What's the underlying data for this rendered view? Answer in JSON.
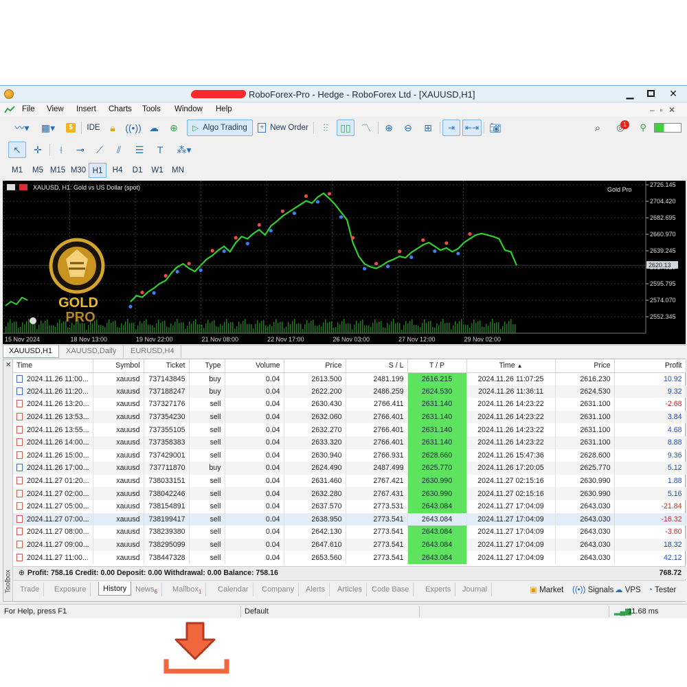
{
  "window": {
    "title": "RoboForex-Pro - Hedge - RoboForex Ltd - [XAUUSD,H1]"
  },
  "menu": [
    "File",
    "View",
    "Insert",
    "Charts",
    "Tools",
    "Window",
    "Help"
  ],
  "toolbar": {
    "ide": "IDE",
    "algo_trading": "Algo Trading",
    "new_order": "New Order",
    "notification_count": "1"
  },
  "timeframes": [
    "M1",
    "M5",
    "M15",
    "M30",
    "H1",
    "H4",
    "D1",
    "W1",
    "MN"
  ],
  "active_timeframe": "H1",
  "chart": {
    "symbol_label": "XAUUSD, H1:  Gold vs US Dollar (spot)",
    "indicator_label": "Gold Pro",
    "logo_text_1": "GOLD",
    "logo_text_2": "PRO",
    "current_price": "2620.13",
    "price_ticks": [
      "2726.145",
      "2704.420",
      "2682.695",
      "2660.970",
      "2639.245",
      "2617.520",
      "2595.795",
      "2574.070",
      "2552.345"
    ],
    "time_ticks": [
      "15 Nov 2024",
      "18 Nov 13:00",
      "19 Nov 22:00",
      "21 Nov 08:00",
      "22 Nov 17:00",
      "26 Nov 03:00",
      "27 Nov 12:00",
      "29 Nov 02:00"
    ],
    "price_min": 2530.62,
    "price_max": 2726.145,
    "series": [
      2572,
      2580,
      2578,
      2585,
      2590,
      2596,
      2600,
      2610,
      2618,
      2622,
      2616,
      2612,
      2620,
      2628,
      2633,
      2640,
      2645,
      2638,
      2650,
      2658,
      2655,
      2662,
      2667,
      2660,
      2672,
      2678,
      2685,
      2690,
      2695,
      2700,
      2705,
      2702,
      2710,
      2715,
      2708,
      2700,
      2690,
      2680,
      2650,
      2632,
      2622,
      2618,
      2616,
      2620,
      2625,
      2628,
      2632,
      2630,
      2637,
      2642,
      2647,
      2650,
      2645,
      2640,
      2643,
      2638,
      2642,
      2650,
      2655,
      2660,
      2662,
      2660,
      2658,
      2655,
      2640,
      2638,
      2620
    ]
  },
  "chart_tabs": [
    "XAUUSD,H1",
    "XAUUSD,Daily",
    "EURUSD,H4"
  ],
  "table": {
    "headers": [
      "Time",
      "Symbol",
      "Ticket",
      "Type",
      "Volume",
      "Price",
      "S / L",
      "T / P",
      "Time",
      "Price",
      "Profit"
    ],
    "rows": [
      [
        "2024.11.26 11:00...",
        "xauusd",
        "737143845",
        "buy",
        "0.04",
        "2613.500",
        "2481.199",
        "2616.215",
        "2024.11.26 11:07:25",
        "2616.230",
        "10.92"
      ],
      [
        "2024.11.26 11:20...",
        "xauusd",
        "737188247",
        "buy",
        "0.04",
        "2622.200",
        "2486.259",
        "2624.530",
        "2024.11.26 11:36:11",
        "2624.530",
        "9.32"
      ],
      [
        "2024.11.26 13:20...",
        "xauusd",
        "737327176",
        "sell",
        "0.04",
        "2630.430",
        "2766.411",
        "2631.140",
        "2024.11.26 14:23:22",
        "2631.100",
        "-2.68"
      ],
      [
        "2024.11.26 13:53...",
        "xauusd",
        "737354230",
        "sell",
        "0.04",
        "2632.060",
        "2766.401",
        "2631.140",
        "2024.11.26 14:23:22",
        "2631.100",
        "3.84"
      ],
      [
        "2024.11.26 13:55...",
        "xauusd",
        "737355105",
        "sell",
        "0.04",
        "2632.270",
        "2766.401",
        "2631.140",
        "2024.11.26 14:23:22",
        "2631.100",
        "4.68"
      ],
      [
        "2024.11.26 14:00...",
        "xauusd",
        "737358383",
        "sell",
        "0.04",
        "2633.320",
        "2766.401",
        "2631.140",
        "2024.11.26 14:23:22",
        "2631.100",
        "8.88"
      ],
      [
        "2024.11.26 15:00...",
        "xauusd",
        "737429001",
        "sell",
        "0.04",
        "2630.940",
        "2766.931",
        "2628.660",
        "2024.11.26 15:47:36",
        "2628.600",
        "9.36"
      ],
      [
        "2024.11.26 17:00...",
        "xauusd",
        "737711870",
        "buy",
        "0.04",
        "2624.490",
        "2487.499",
        "2625.770",
        "2024.11.26 17:20:05",
        "2625.770",
        "5.12"
      ],
      [
        "2024.11.27 01:20...",
        "xauusd",
        "738033151",
        "sell",
        "0.04",
        "2631.460",
        "2767.421",
        "2630.990",
        "2024.11.27 02:15:16",
        "2630.990",
        "1.88"
      ],
      [
        "2024.11.27 02:00...",
        "xauusd",
        "738042246",
        "sell",
        "0.04",
        "2632.280",
        "2767.431",
        "2630.990",
        "2024.11.27 02:15:16",
        "2630.990",
        "5.16"
      ],
      [
        "2024.11.27 05:00...",
        "xauusd",
        "738154891",
        "sell",
        "0.04",
        "2637.570",
        "2773.531",
        "2643.084",
        "2024.11.27 17:04:09",
        "2643.030",
        "-21.84"
      ],
      [
        "2024.11.27 07:00...",
        "xauusd",
        "738199417",
        "sell",
        "0.04",
        "2638.950",
        "2773.541",
        "2643.084",
        "2024.11.27 17:04:09",
        "2643.030",
        "-16.32"
      ],
      [
        "2024.11.27 08:00...",
        "xauusd",
        "738239380",
        "sell",
        "0.04",
        "2642.130",
        "2773.541",
        "2643.084",
        "2024.11.27 17:04:09",
        "2643.030",
        "-3.60"
      ],
      [
        "2024.11.27 09:00...",
        "xauusd",
        "738295099",
        "sell",
        "0.04",
        "2647.610",
        "2773.541",
        "2643.084",
        "2024.11.27 17:04:09",
        "2643.030",
        "18.32"
      ],
      [
        "2024.11.27 11:00...",
        "xauusd",
        "738447328",
        "sell",
        "0.04",
        "2653.560",
        "2773.541",
        "2643.084",
        "2024.11.27 17:04:09",
        "2643.030",
        "42.12"
      ]
    ],
    "selected_row": 11
  },
  "summary": {
    "text": "Profit: 758.16  Credit: 0.00  Deposit: 0.00  Withdrawal: 0.00  Balance: 758.16",
    "total": "768.72"
  },
  "toolbox_label": "Toolbox",
  "bottom_tabs": [
    {
      "label": "Trade",
      "badge": ""
    },
    {
      "label": "Exposure",
      "badge": ""
    },
    {
      "label": "History",
      "badge": ""
    },
    {
      "label": "News",
      "badge": "6"
    },
    {
      "label": "Mailbox",
      "badge": "1"
    },
    {
      "label": "Calendar",
      "badge": ""
    },
    {
      "label": "Company",
      "badge": ""
    },
    {
      "label": "Alerts",
      "badge": ""
    },
    {
      "label": "Articles",
      "badge": ""
    },
    {
      "label": "Code Base",
      "badge": ""
    },
    {
      "label": "Experts",
      "badge": ""
    },
    {
      "label": "Journal",
      "badge": ""
    }
  ],
  "active_bottom_tab": "History",
  "right_tools": [
    "Market",
    "Signals",
    "VPS",
    "Tester"
  ],
  "status": {
    "help": "For Help, press F1",
    "profile": "Default",
    "ping": "11.68 ms"
  },
  "colors": {
    "tp_highlight": "#5ee35e",
    "profit_positive": "#1d4fb8",
    "profit_negative": "#c92a1f",
    "chart_line": "#2fd02f",
    "download_arrow": "#e8553a"
  }
}
